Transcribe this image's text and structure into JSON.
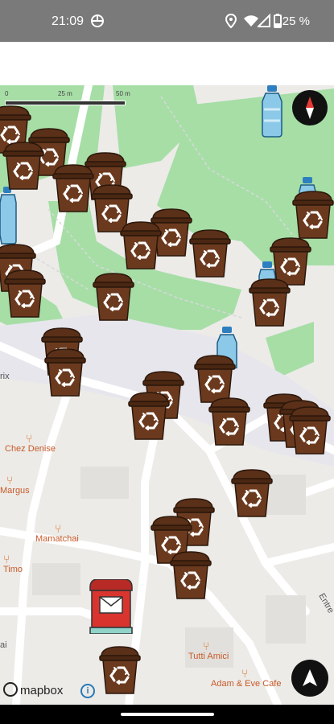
{
  "status_bar": {
    "time": "21:09",
    "battery": "25 %"
  },
  "map": {
    "scale_labels": [
      "0",
      "25 m",
      "50 m"
    ],
    "poi": [
      {
        "name": "Chez Denise"
      },
      {
        "name": "Margus"
      },
      {
        "name": "Mamatchai"
      },
      {
        "name": "Timo"
      },
      {
        "name": "Tutti Amici"
      },
      {
        "name": "Adam & Eve Cafe"
      }
    ],
    "street_labels": {
      "left": "rix",
      "right": "Entre",
      "bottom_left": "ai"
    },
    "colors": {
      "park": "#a6dea6",
      "land": "#ecebe8",
      "road": "#ffffff",
      "bin": "#6b3a1e",
      "bottle": "#8cc9e8",
      "postbox": "#d9352e",
      "poi_text": "#c85a2a"
    },
    "markers": {
      "recycling_bin_icon": "recycle-icon",
      "bottle_icon": "water-bottle-icon",
      "postbox_icon": "mailbox-icon"
    }
  },
  "attribution": {
    "brand": "mapbox",
    "info": "i"
  },
  "controls": {
    "compass_icon": "compass-icon",
    "locate_icon": "navigation-arrow-icon"
  }
}
